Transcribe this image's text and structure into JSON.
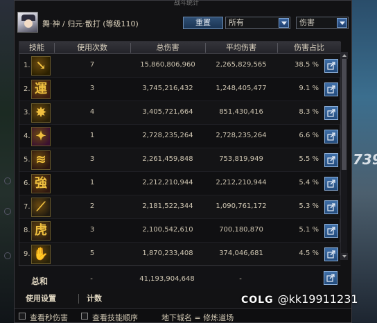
{
  "window": {
    "title": "战斗统计"
  },
  "character": {
    "title": "舞·神 / 归元·散打 (等级110)"
  },
  "controls": {
    "reset_label": "重置",
    "filter_selected": "所有",
    "metric_selected": "伤害"
  },
  "table": {
    "headers": [
      "技能",
      "使用次数",
      "总伤害",
      "平均伤害",
      "伤害占比"
    ],
    "rows": [
      {
        "rank": "1.",
        "icon": "lightning-arrow-skill-icon",
        "glyph": "↘",
        "uses": "7",
        "total": "15,860,806,960",
        "avg": "2,265,829,565",
        "share": "38.5 %"
      },
      {
        "rank": "2.",
        "icon": "yun-skill-icon",
        "glyph": "運",
        "uses": "3",
        "total": "3,745,216,432",
        "avg": "1,248,405,477",
        "share": "9.1 %"
      },
      {
        "rank": "3.",
        "icon": "burst-skill-icon",
        "glyph": "✸",
        "uses": "4",
        "total": "3,405,721,664",
        "avg": "851,430,416",
        "share": "8.3 %"
      },
      {
        "rank": "4.",
        "icon": "strike-skill-icon",
        "glyph": "✦",
        "uses": "1",
        "total": "2,728,235,264",
        "avg": "2,728,235,264",
        "share": "6.6 %"
      },
      {
        "rank": "5.",
        "icon": "swirl-skill-icon",
        "glyph": "≋",
        "uses": "3",
        "total": "2,261,459,848",
        "avg": "753,819,949",
        "share": "5.5 %"
      },
      {
        "rank": "6.",
        "icon": "qiang-skill-icon",
        "glyph": "強",
        "uses": "1",
        "total": "2,212,210,944",
        "avg": "2,212,210,944",
        "share": "5.4 %"
      },
      {
        "rank": "7.",
        "icon": "slash-skill-icon",
        "glyph": "⟋",
        "uses": "2",
        "total": "2,181,522,344",
        "avg": "1,090,761,172",
        "share": "5.3 %"
      },
      {
        "rank": "8.",
        "icon": "hu-skill-icon",
        "glyph": "虎",
        "uses": "3",
        "total": "2,100,542,610",
        "avg": "700,180,870",
        "share": "5.1 %"
      },
      {
        "rank": "9.",
        "icon": "palm-skill-icon",
        "glyph": "✋",
        "uses": "5",
        "total": "1,870,233,408",
        "avg": "374,046,681",
        "share": "4.5 %"
      }
    ],
    "total": {
      "label": "总和",
      "uses": "-",
      "total": "41,193,904,648",
      "avg": "-"
    }
  },
  "tabs": {
    "settings": "使用设置",
    "count": "计数"
  },
  "footer": {
    "check_dps": "查看秒伤害",
    "check_order": "查看技能顺序",
    "dungeon": "地下城名 = 修炼道场"
  },
  "watermark": {
    "logo": "COLG",
    "handle": "@kk19911231"
  },
  "scene": {
    "right_number": "739"
  },
  "colors": {
    "accent_blue": "#2f4f74",
    "icon_gold": "#f0c040",
    "panel_bg": "#121214"
  }
}
